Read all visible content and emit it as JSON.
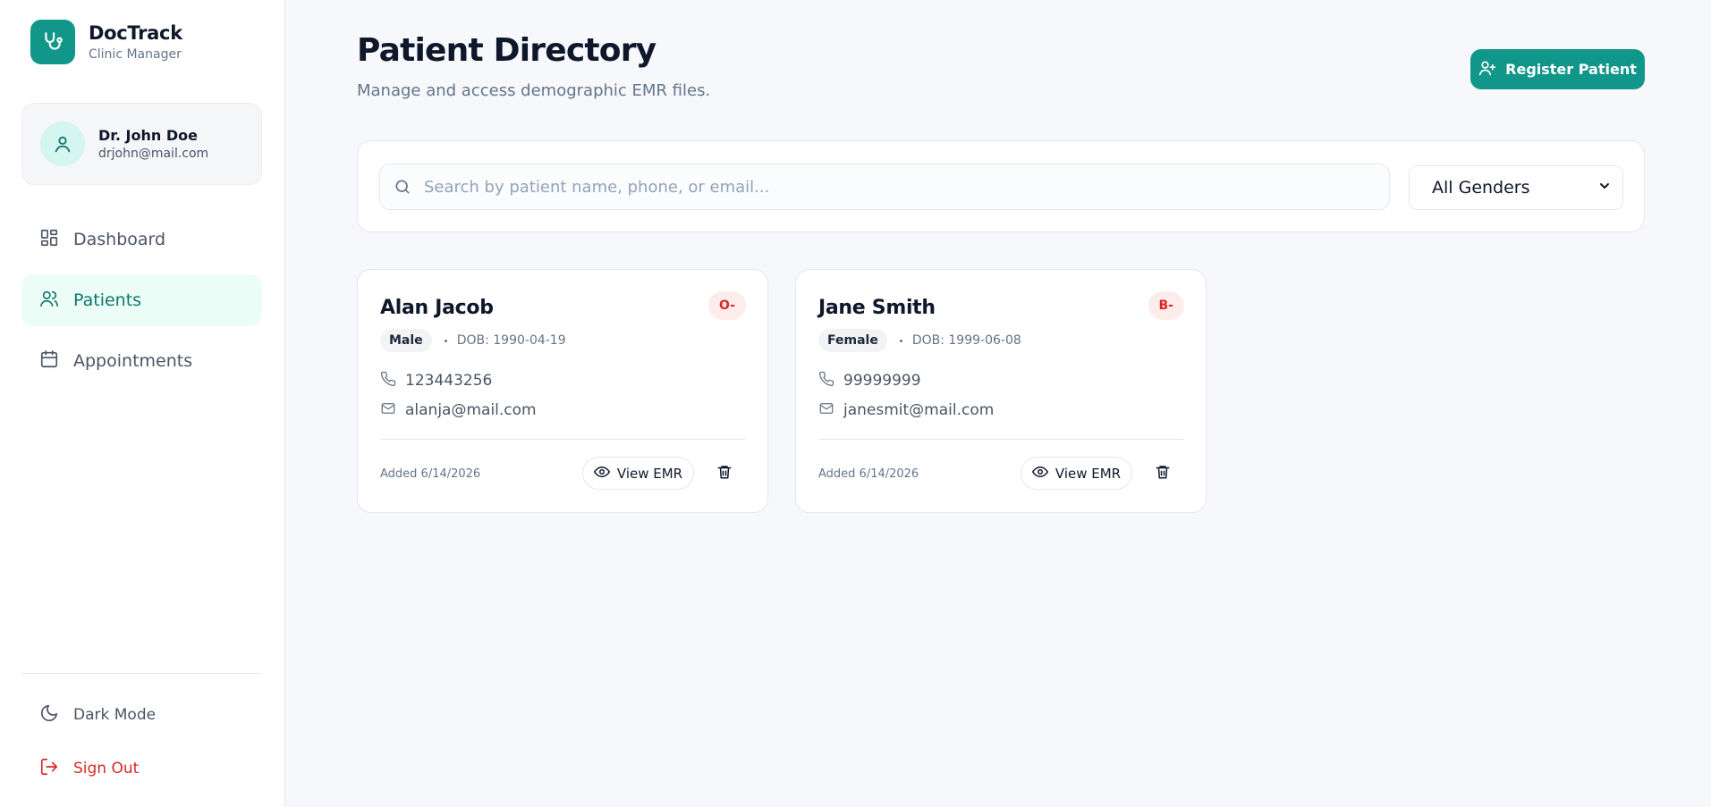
{
  "brand": {
    "name": "DocTrack",
    "subtitle": "Clinic Manager"
  },
  "user": {
    "name": "Dr. John Doe",
    "email": "drjohn@mail.com"
  },
  "nav": {
    "items": [
      {
        "label": "Dashboard",
        "icon": "dashboard-icon",
        "active": false
      },
      {
        "label": "Patients",
        "icon": "users-icon",
        "active": true
      },
      {
        "label": "Appointments",
        "icon": "calendar-icon",
        "active": false
      }
    ],
    "dark_mode": "Dark Mode",
    "sign_out": "Sign Out"
  },
  "header": {
    "title": "Patient Directory",
    "subtitle": "Manage and access demographic EMR files.",
    "register_label": "Register Patient"
  },
  "filters": {
    "search_placeholder": "Search by patient name, phone, or email...",
    "search_value": "",
    "gender_selected": "All Genders"
  },
  "patients": [
    {
      "name": "Alan Jacob",
      "blood_group": "O-",
      "gender": "Male",
      "dob": "DOB: 1990-04-19",
      "phone": "123443256",
      "email": "alanja@mail.com",
      "added": "Added 6/14/2026",
      "view_label": "View EMR"
    },
    {
      "name": "Jane Smith",
      "blood_group": "B-",
      "gender": "Female",
      "dob": "DOB: 1999-06-08",
      "phone": "99999999",
      "email": "janesmit@mail.com",
      "added": "Added 6/14/2026",
      "view_label": "View EMR"
    }
  ],
  "colors": {
    "accent": "#11968a",
    "accent_light": "#ecfdf7",
    "danger": "#dc2626",
    "danger_light": "#fdecec",
    "background": "#f7f8fb"
  }
}
